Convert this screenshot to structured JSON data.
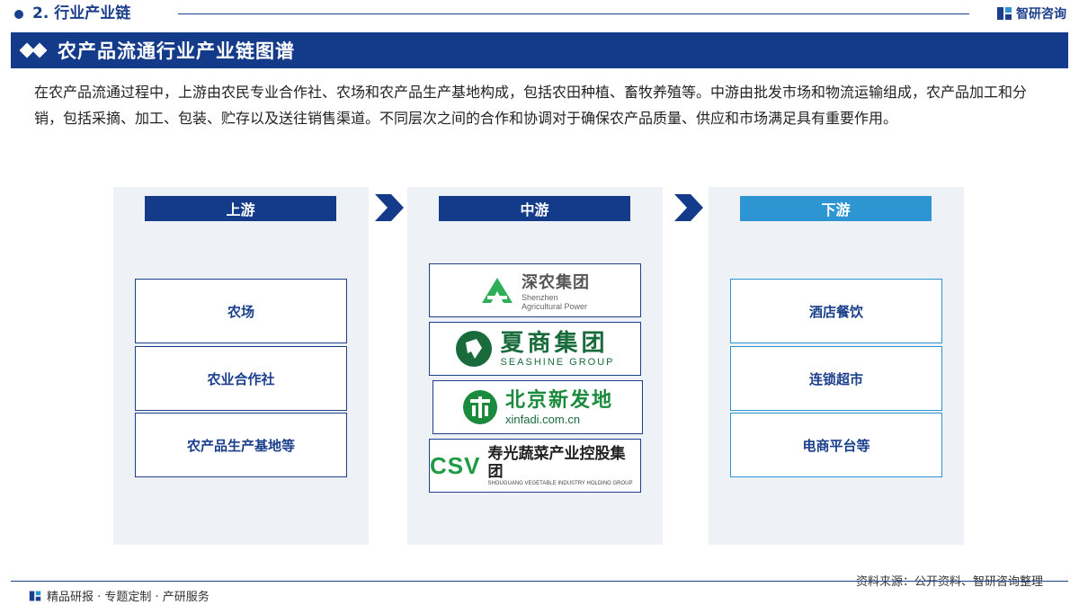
{
  "header": {
    "section_title": "2. 行业产业链",
    "brand": "智研咨询"
  },
  "banner": {
    "title": "农产品流通行业产业链图谱"
  },
  "intro": "在农产品流通过程中，上游由农民专业合作社、农场和农产品生产基地构成，包括农田种植、畜牧养殖等。中游由批发市场和物流运输组成，农产品加工和分销，包括采摘、加工、包装、贮存以及送往销售渠道。不同层次之间的合作和协调对于确保农产品质量、供应和市场满足具有重要作用。",
  "upstream": {
    "heading": "上游",
    "items": [
      "农场",
      "农业合作社",
      "农产品生产基地等"
    ]
  },
  "midstream": {
    "heading": "中游",
    "logos": [
      {
        "cn": "深农集团",
        "en1": "Shenzhen",
        "en2": "Agricultural Power",
        "icon": "shennong-logo-icon"
      },
      {
        "cn": "夏商集团",
        "en": "SEASHINE GROUP",
        "icon": "xiashang-logo-icon"
      },
      {
        "cn": "北京新发地",
        "en": "xinfadi.com.cn",
        "icon": "xinfadi-logo-icon"
      },
      {
        "mark": "CSV",
        "cn": "寿光蔬菜产业控股集团",
        "en": "SHOUGUANG VEGETABLE INDUSTRY HOLDING GROUP",
        "icon": "csv-logo-icon"
      }
    ]
  },
  "downstream": {
    "heading": "下游",
    "items": [
      "酒店餐饮",
      "连锁超市",
      "电商平台等"
    ]
  },
  "footer": {
    "left": "精品研报 · 专题定制 · 产研服务",
    "source": "资料来源：公开资料、智研咨询整理"
  },
  "colors": {
    "primary": "#143a8a",
    "downstream": "#2e95d3",
    "column_bg": "#eef1f6"
  }
}
